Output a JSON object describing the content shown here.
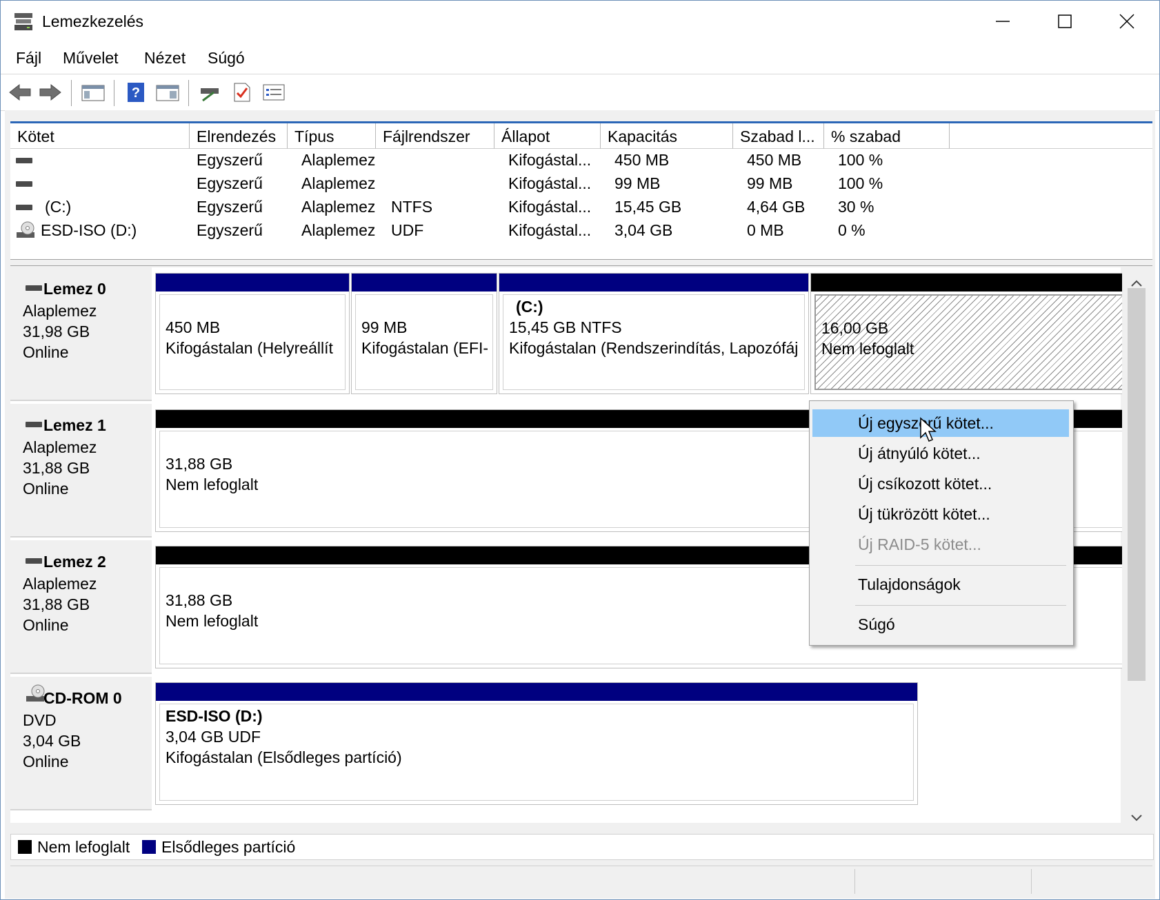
{
  "window": {
    "title": "Lemezkezelés",
    "controls": [
      "minimize-icon",
      "maximize-icon",
      "close-icon"
    ]
  },
  "menubar": [
    "Fájl",
    "Művelet",
    "Nézet",
    "Súgó"
  ],
  "toolbar": {
    "icons": [
      "back-arrow-icon",
      "forward-arrow-icon",
      "console-tree-icon",
      "help-icon",
      "action-pane-icon",
      "connect-icon",
      "properties-icon",
      "view-icon"
    ]
  },
  "volume_list": {
    "columns": [
      "Kötet",
      "Elrendezés",
      "Típus",
      "Fájlrendszer",
      "Állapot",
      "Kapacitás",
      "Szabad l...",
      "% szabad"
    ],
    "rows": [
      {
        "icon": "volume-icon",
        "name": "",
        "layout": "Egyszerű",
        "type": "Alaplemez",
        "fs": "",
        "status": "Kifogástal...",
        "capacity": "450 MB",
        "free": "450 MB",
        "pct": "100 %"
      },
      {
        "icon": "volume-icon",
        "name": "",
        "layout": "Egyszerű",
        "type": "Alaplemez",
        "fs": "",
        "status": "Kifogástal...",
        "capacity": "99 MB",
        "free": "99 MB",
        "pct": "100 %"
      },
      {
        "icon": "volume-icon",
        "name": "(C:)",
        "layout": "Egyszerű",
        "type": "Alaplemez",
        "fs": "NTFS",
        "status": "Kifogástal...",
        "capacity": "15,45 GB",
        "free": "4,64 GB",
        "pct": "30 %"
      },
      {
        "icon": "cd-icon",
        "name": "ESD-ISO (D:)",
        "layout": "Egyszerű",
        "type": "Alaplemez",
        "fs": "UDF",
        "status": "Kifogástal...",
        "capacity": "3,04 GB",
        "free": "0 MB",
        "pct": "0 %"
      }
    ]
  },
  "disks": [
    {
      "name": "Lemez 0",
      "type": "Alaplemez",
      "size": "31,98 GB",
      "status": "Online",
      "partitions": [
        {
          "title": "",
          "line1": "450 MB",
          "line2": "Kifogástalan (Helyreállít",
          "kind": "primary"
        },
        {
          "title": "",
          "line1": "99 MB",
          "line2": "Kifogástalan (EFI-",
          "kind": "primary"
        },
        {
          "title": "(C:)",
          "line1": "15,45 GB NTFS",
          "line2": "Kifogástalan (Rendszerindítás, Lapozófáj",
          "kind": "primary"
        },
        {
          "title": "",
          "line1": "16,00 GB",
          "line2": "Nem lefoglalt",
          "kind": "unallocated"
        }
      ]
    },
    {
      "name": "Lemez 1",
      "type": "Alaplemez",
      "size": "31,88 GB",
      "status": "Online",
      "partitions": [
        {
          "title": "",
          "line1": "31,88 GB",
          "line2": "Nem lefoglalt",
          "kind": "unallocated"
        }
      ]
    },
    {
      "name": "Lemez 2",
      "type": "Alaplemez",
      "size": "31,88 GB",
      "status": "Online",
      "partitions": [
        {
          "title": "",
          "line1": "31,88 GB",
          "line2": "Nem lefoglalt",
          "kind": "unallocated"
        }
      ]
    },
    {
      "name": "CD-ROM 0",
      "type": "DVD",
      "size": "3,04 GB",
      "status": "Online",
      "partitions": [
        {
          "title": "ESD-ISO  (D:)",
          "line1": "3,04 GB UDF",
          "line2": "Kifogástalan (Elsődleges partíció)",
          "kind": "primary"
        }
      ]
    }
  ],
  "legend": [
    {
      "label": "Nem lefoglalt",
      "color": "#000000"
    },
    {
      "label": "Elsődleges partíció",
      "color": "#000080"
    }
  ],
  "context_menu": {
    "items": [
      {
        "label": "Új egyszerű kötet...",
        "state": "highlighted"
      },
      {
        "label": "Új átnyúló kötet...",
        "state": "enabled"
      },
      {
        "label": "Új csíkozott kötet...",
        "state": "enabled"
      },
      {
        "label": "Új tükrözött kötet...",
        "state": "enabled"
      },
      {
        "label": "Új RAID-5 kötet...",
        "state": "disabled"
      },
      {
        "label": "Tulajdonságok",
        "state": "enabled"
      },
      {
        "label": "Súgó",
        "state": "enabled"
      }
    ]
  },
  "colors": {
    "primary_partition": "#000080",
    "unallocated": "#000000",
    "menu_highlight": "#91c9f7",
    "disabled_text": "#8c8c8c"
  }
}
